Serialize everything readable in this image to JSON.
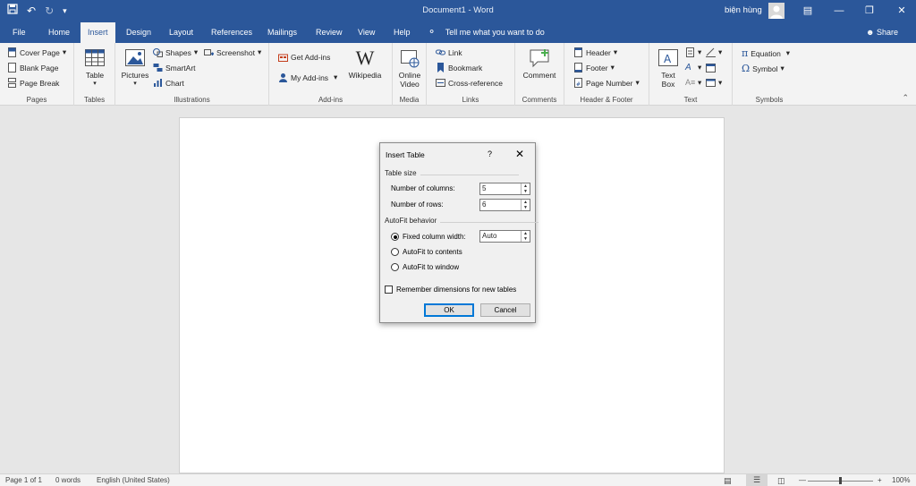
{
  "window": {
    "title": "Document1 - Word",
    "user": "biện hùng",
    "accent": "#2b579a"
  },
  "tabs": [
    "File",
    "Home",
    "Insert",
    "Design",
    "Layout",
    "References",
    "Mailings",
    "Review",
    "View",
    "Help"
  ],
  "active_tab": "Insert",
  "tell_me": "Tell me what you want to do",
  "share": "Share",
  "ribbon": {
    "pages": {
      "label": "Pages",
      "items": [
        "Cover Page",
        "Blank Page",
        "Page Break"
      ]
    },
    "tables": {
      "label": "Tables",
      "table": "Table"
    },
    "illustrations": {
      "label": "Illustrations",
      "pictures": "Pictures",
      "shapes": "Shapes",
      "smartart": "SmartArt",
      "chart": "Chart",
      "screenshot": "Screenshot"
    },
    "addins": {
      "label": "Add-ins",
      "get": "Get Add-ins",
      "my": "My Add-ins",
      "wikipedia": "Wikipedia"
    },
    "media": {
      "label": "Media",
      "online_video_1": "Online",
      "online_video_2": "Video"
    },
    "links": {
      "label": "Links",
      "link": "Link",
      "bookmark": "Bookmark",
      "crossref": "Cross-reference"
    },
    "comments": {
      "label": "Comments",
      "comment": "Comment"
    },
    "header_footer": {
      "label": "Header & Footer",
      "header": "Header",
      "footer": "Footer",
      "page_number": "Page Number"
    },
    "text": {
      "label": "Text",
      "textbox_1": "Text",
      "textbox_2": "Box"
    },
    "symbols": {
      "label": "Symbols",
      "equation": "Equation",
      "symbol": "Symbol"
    }
  },
  "dialog": {
    "title": "Insert Table",
    "help": "?",
    "table_size": "Table size",
    "columns_label": "Number of columns:",
    "columns_value": "5",
    "rows_label": "Number of rows:",
    "rows_value": "6",
    "autofit": "AutoFit behavior",
    "fixed": "Fixed column width:",
    "fixed_value": "Auto",
    "to_contents": "AutoFit to contents",
    "to_window": "AutoFit to window",
    "remember": "Remember dimensions for new tables",
    "ok": "OK",
    "cancel": "Cancel"
  },
  "status": {
    "page": "Page 1 of 1",
    "words": "0 words",
    "language": "English (United States)",
    "zoom": "100%",
    "zoom_fraction": 0.5
  }
}
